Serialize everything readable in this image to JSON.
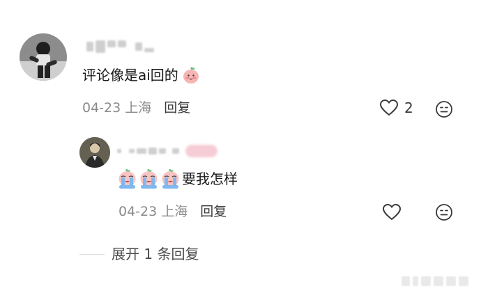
{
  "comment": {
    "text": "评论像是ai回的",
    "date": "04-23",
    "location": "上海",
    "reply_label": "回复",
    "like_count": "2",
    "emoji": "peach-face-emoji"
  },
  "reply": {
    "text": "要我怎样",
    "date": "04-23",
    "location": "上海",
    "reply_label": "回复",
    "emoji": "crying-face-emoji"
  },
  "expand_label": "展开 1 条回复",
  "colors": {
    "meta_gray": "#8a8a8a",
    "text": "#1a1a1a",
    "icon": "#3a3a3a"
  }
}
